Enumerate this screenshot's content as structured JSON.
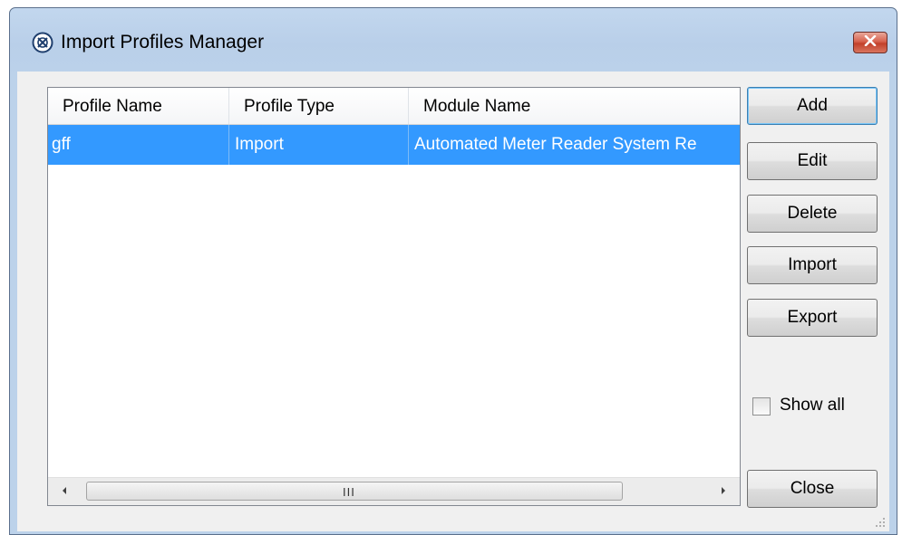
{
  "window": {
    "title": "Import Profiles Manager",
    "icon": "app-logo-icon",
    "close_icon": "close-icon"
  },
  "listview": {
    "columns": [
      "Profile Name",
      "Profile Type",
      "Module Name"
    ],
    "rows": [
      {
        "profile_name": "gff",
        "profile_type": "Import",
        "module_name": "Automated Meter Reader System Re",
        "selected": true
      }
    ],
    "scrollbar": {
      "left_icon": "scroll-left-icon",
      "right_icon": "scroll-right-icon",
      "grip": "III"
    }
  },
  "buttons": {
    "add": "Add",
    "edit": "Edit",
    "delete": "Delete",
    "import": "Import",
    "export": "Export",
    "close": "Close"
  },
  "show_all": {
    "label": "Show all",
    "checked": false
  },
  "colors": {
    "selection": "#3399ff",
    "title_bar": "#b9cfe9",
    "close_button": "#c7432d",
    "client_background": "#f0f0f0"
  }
}
